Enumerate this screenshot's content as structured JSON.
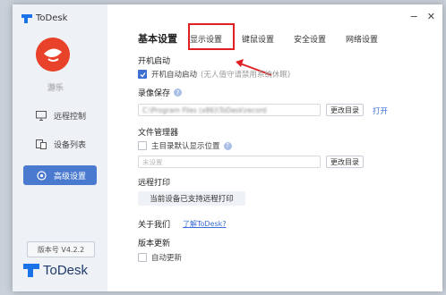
{
  "app": {
    "title": "ToDesk",
    "brand_color": "#1a73e8"
  },
  "user": {
    "name": "游乐"
  },
  "sidebar": {
    "items": [
      {
        "label": "远程控制",
        "icon": "remote-control-icon"
      },
      {
        "label": "设备列表",
        "icon": "device-list-icon"
      },
      {
        "label": "高级设置",
        "icon": "settings-icon",
        "active": true
      }
    ],
    "version": "版本号 V4.2.2",
    "bottom_brand": "ToDesk"
  },
  "window_controls": {
    "minimize": "−",
    "close": "✕"
  },
  "tabs": {
    "title": "基本设置",
    "items": [
      "显示设置",
      "键鼠设置",
      "安全设置",
      "网络设置"
    ],
    "highlighted": "显示设置"
  },
  "sections": {
    "startup": {
      "title": "开机启动",
      "option_label": "开机自动启动",
      "option_checked": true,
      "option_hint": "(无人值守请禁用系统休眠)"
    },
    "recording": {
      "title": "录像保存",
      "path_value": "C:\\Program Files (x86)\\ToDesk\\record",
      "change_button": "更改目录",
      "open_link": "打开"
    },
    "files": {
      "title": "文件管理器",
      "option_label": "主目录默认显示位置",
      "option_checked": false,
      "path_placeholder": "未设置",
      "change_button": "更改目录"
    },
    "remote_print": {
      "title": "远程打印",
      "button": "当前设备已支持远程打印"
    },
    "about": {
      "title": "关于我们",
      "link": "了解ToDesk?"
    },
    "update": {
      "title": "版本更新",
      "option_label": "自动更新",
      "option_checked": false
    }
  },
  "colors": {
    "accent": "#3b6fd4",
    "active_nav": "#4a7ad0",
    "annotation": "#e02020"
  }
}
